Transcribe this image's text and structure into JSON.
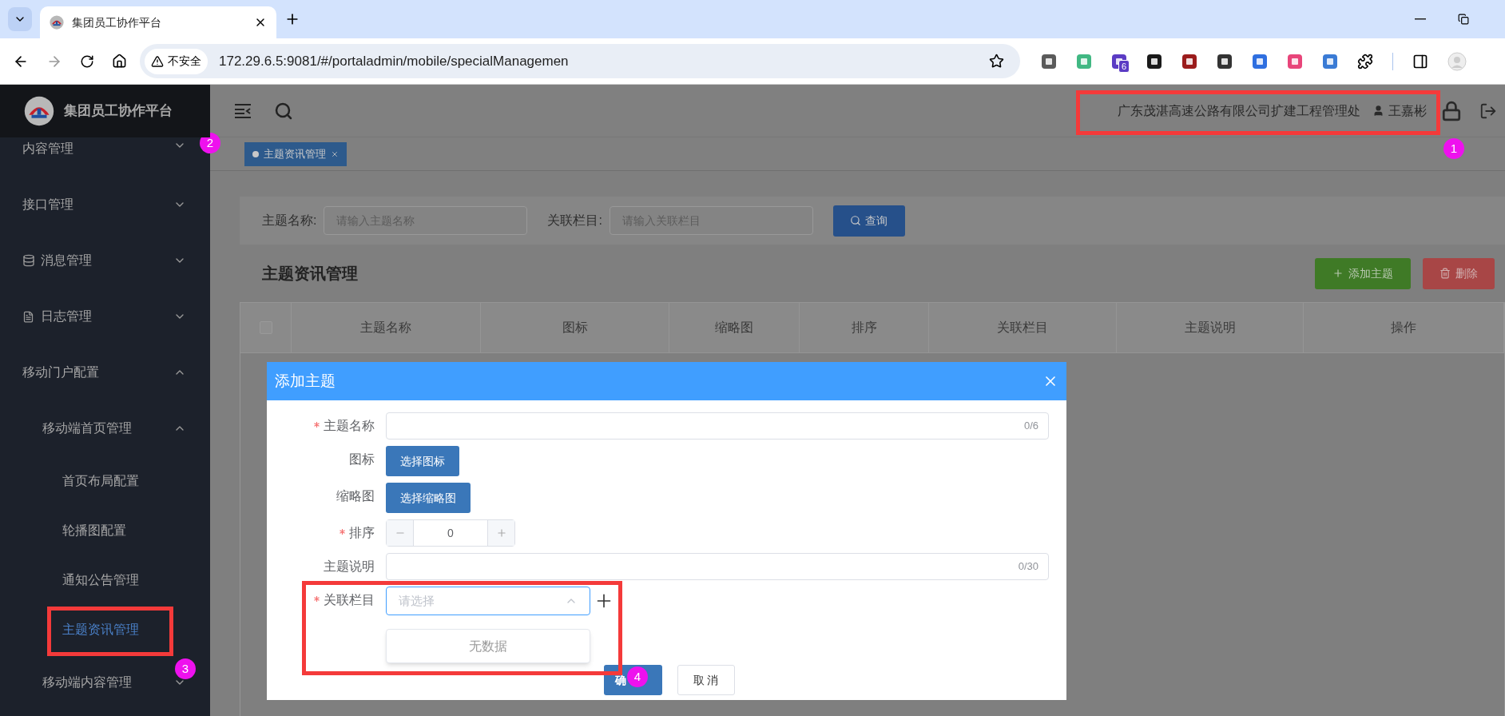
{
  "browser": {
    "tab_title": "集团员工协作平台",
    "security_label": "不安全",
    "url": "172.29.6.5:9081/#/portaladmin/mobile/specialManagemen",
    "extension_badge": "6"
  },
  "sidebar": {
    "app_name": "集团员工协作平台",
    "items": [
      {
        "label": "内容管理",
        "selected": false,
        "expanded": false
      },
      {
        "label": "接口管理",
        "selected": false,
        "expanded": false
      },
      {
        "label": "消息管理",
        "selected": false,
        "expanded": false
      },
      {
        "label": "日志管理",
        "selected": false,
        "expanded": false
      },
      {
        "label": "移动门户配置",
        "selected": false,
        "expanded": true,
        "children": [
          {
            "label": "移动端首页管理",
            "selected": false,
            "expanded": true,
            "children": [
              {
                "label": "首页布局配置",
                "selected": false
              },
              {
                "label": "轮播图配置",
                "selected": false
              },
              {
                "label": "通知公告管理",
                "selected": false
              },
              {
                "label": "主题资讯管理",
                "selected": true
              }
            ]
          },
          {
            "label": "移动端内容管理",
            "selected": false,
            "expanded": false
          }
        ]
      }
    ]
  },
  "header": {
    "organization": "广东茂湛高速公路有限公司扩建工程管理处",
    "user": "王嘉彬"
  },
  "tabs": [
    {
      "label": "主题资讯管理",
      "selected": true
    }
  ],
  "search": {
    "fields": [
      {
        "label": "主题名称:",
        "placeholder": "请输入主题名称"
      },
      {
        "label": "关联栏目:",
        "placeholder": "请输入关联栏目"
      }
    ],
    "button": "查询"
  },
  "page": {
    "title": "主题资讯管理",
    "add_button": "添加主题",
    "delete_button": "删除"
  },
  "table": {
    "select_all": {
      "checked": false
    },
    "columns": [
      "主题名称",
      "图标",
      "缩略图",
      "排序",
      "关联栏目",
      "主题说明",
      "操作"
    ]
  },
  "dialog": {
    "title": "添加主题",
    "fields": [
      {
        "kind": "text",
        "label": "主题名称",
        "required": true,
        "counter": "0/6"
      },
      {
        "kind": "button",
        "label": "图标",
        "required": false,
        "button": "选择图标"
      },
      {
        "kind": "button",
        "label": "缩略图",
        "required": false,
        "button": "选择缩略图"
      },
      {
        "kind": "number",
        "label": "排序",
        "required": true,
        "value": "0"
      },
      {
        "kind": "text",
        "label": "主题说明",
        "required": false,
        "counter": "0/30"
      },
      {
        "kind": "select",
        "label": "关联栏目",
        "required": true,
        "placeholder": "请选择",
        "open": true,
        "empty_text": "无数据"
      }
    ],
    "confirm_button": "确",
    "cancel_button": "取 消"
  },
  "annotations": [
    {
      "number": "1"
    },
    {
      "number": "2"
    },
    {
      "number": "3"
    },
    {
      "number": "4"
    }
  ]
}
